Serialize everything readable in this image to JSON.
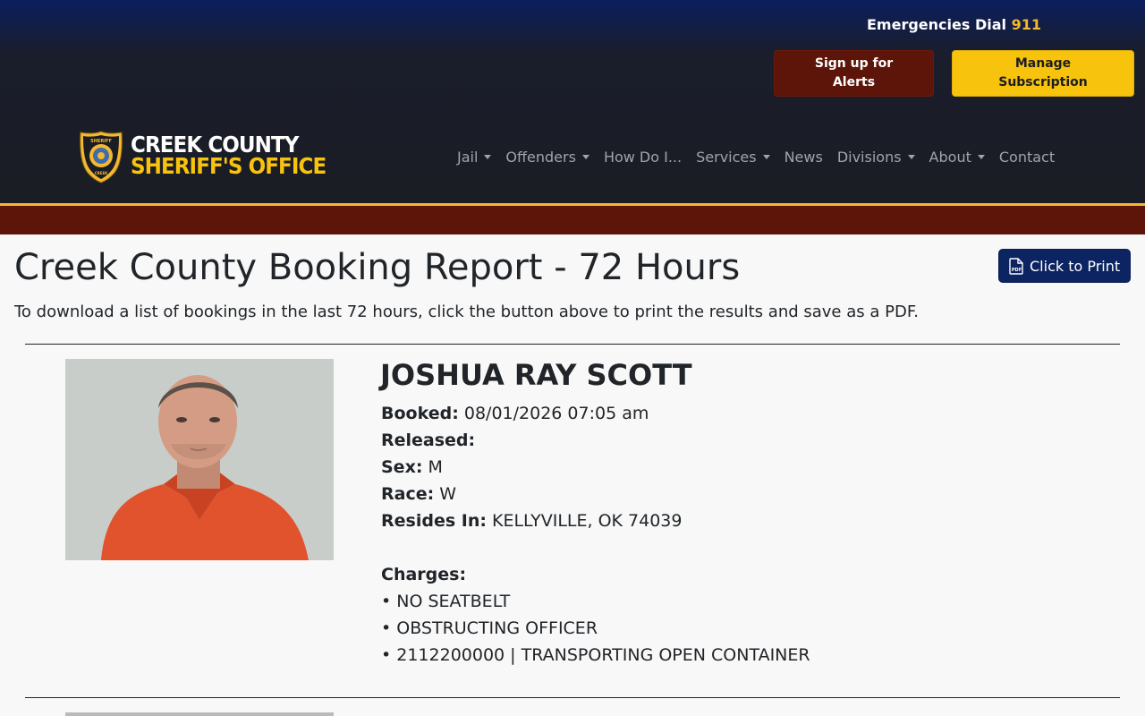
{
  "header": {
    "emergency_label": "Emergencies Dial",
    "emergency_number": "911",
    "alerts_button": "Sign up for Alerts",
    "manage_button": "Manage Subscription",
    "logo": {
      "line1": "CREEK COUNTY",
      "line2": "SHERIFF'S OFFICE",
      "badge_text_top": "SHERIFF",
      "badge_text_bottom": "CREEK COUNTY"
    },
    "nav": [
      {
        "label": "Jail",
        "dropdown": true
      },
      {
        "label": "Offenders",
        "dropdown": true
      },
      {
        "label": "How Do I...",
        "dropdown": false
      },
      {
        "label": "Services",
        "dropdown": true
      },
      {
        "label": "News",
        "dropdown": false
      },
      {
        "label": "Divisions",
        "dropdown": true
      },
      {
        "label": "About",
        "dropdown": true
      },
      {
        "label": "Contact",
        "dropdown": false
      }
    ]
  },
  "main": {
    "title": "Creek County Booking Report - 72 Hours",
    "print_button": "Click to Print",
    "instructions": "To download a list of bookings in the last 72 hours, click the button above to print the results and save as a PDF."
  },
  "bookings": [
    {
      "name": "JOSHUA RAY SCOTT",
      "booked_label": "Booked:",
      "booked": "08/01/2026 07:05 am",
      "released_label": "Released:",
      "released": "",
      "sex_label": "Sex:",
      "sex": "M",
      "race_label": "Race:",
      "race": "W",
      "resides_label": "Resides In:",
      "resides": "KELLYVILLE, OK 74039",
      "charges_label": "Charges:",
      "charges": [
        "• NO SEATBELT",
        "• OBSTRUCTING OFFICER",
        "• 2112200000 | TRANSPORTING OPEN CONTAINER"
      ]
    }
  ],
  "colors": {
    "header_top": "#0b1f5e",
    "header_bg": "#1b1d24",
    "accent_gold": "#f8c30c",
    "maroon": "#5c1508",
    "print_button": "#0c2461"
  }
}
